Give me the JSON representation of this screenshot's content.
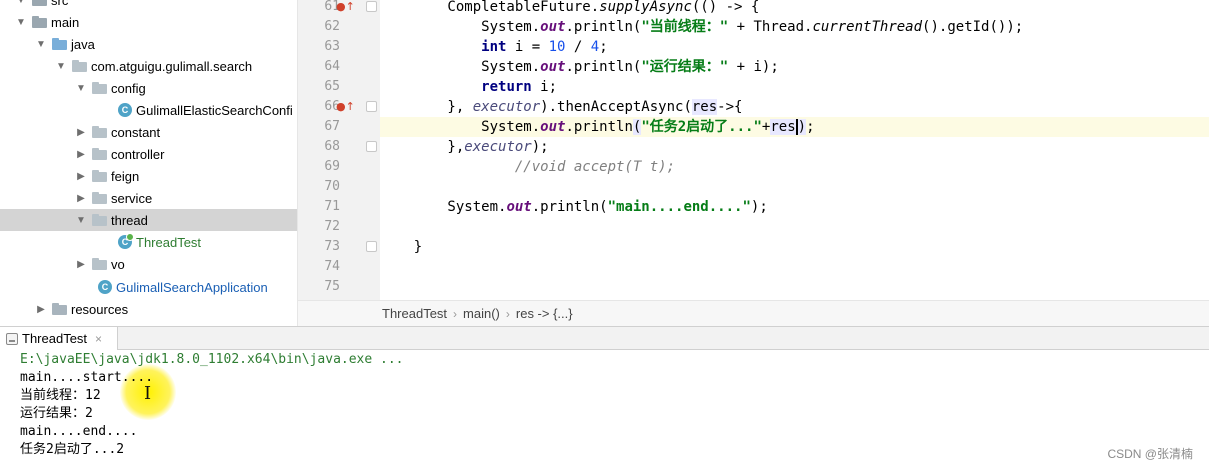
{
  "tree": {
    "items": [
      {
        "label": "src",
        "kind": "folder"
      },
      {
        "label": "main",
        "kind": "folder"
      },
      {
        "label": "java",
        "kind": "folder"
      },
      {
        "label": "com.atguigu.gulimall.search",
        "kind": "package"
      },
      {
        "label": "config",
        "kind": "package"
      },
      {
        "label": "GulimallElasticSearchConfi",
        "kind": "class"
      },
      {
        "label": "constant",
        "kind": "package"
      },
      {
        "label": "controller",
        "kind": "package"
      },
      {
        "label": "feign",
        "kind": "package"
      },
      {
        "label": "service",
        "kind": "package"
      },
      {
        "label": "thread",
        "kind": "package"
      },
      {
        "label": "ThreadTest",
        "kind": "class"
      },
      {
        "label": "vo",
        "kind": "package"
      },
      {
        "label": "GulimallSearchApplication",
        "kind": "class"
      },
      {
        "label": "resources",
        "kind": "folder"
      }
    ]
  },
  "editor": {
    "line_numbers": [
      "61",
      "62",
      "63",
      "64",
      "65",
      "66",
      "67",
      "68",
      "69",
      "70",
      "71",
      "72",
      "73",
      "74",
      "75"
    ],
    "lines": {
      "l61_a": "        CompletableFuture.",
      "l61_b": "supplyAsync",
      "l61_c": "(() -> {",
      "l62_a": "            System.",
      "l62_out": "out",
      "l62_b": ".println(",
      "l62_str": "\"当前线程：\"",
      "l62_c": " + Thread.",
      "l62_d": "currentThread",
      "l62_e": "().getId());",
      "l63_kw": "int",
      "l63_a": " i = ",
      "l63_n1": "10",
      "l63_b": " / ",
      "l63_n2": "4",
      "l63_c": ";",
      "l64_a": "            System.",
      "l64_out": "out",
      "l64_b": ".println(",
      "l64_str": "\"运行结果：\"",
      "l64_c": " + i);",
      "l65_kw": "return",
      "l65_a": " i;",
      "l66_a": "        }, ",
      "l66_exec": "executor",
      "l66_b": ").thenAcceptAsync(",
      "l66_res": "res",
      "l66_c": "->{",
      "l67_a": "            System.",
      "l67_out": "out",
      "l67_b": ".println",
      "l67_p1": "(",
      "l67_str": "\"任务2启动了...\"",
      "l67_c": "+",
      "l67_res": "res",
      "l67_p2": ")",
      "l67_d": ";",
      "l68_a": "        },",
      "l68_exec": "executor",
      "l68_b": ");",
      "l69_cm": "//void accept(T t);",
      "l71_a": "        System.",
      "l71_out": "out",
      "l71_b": ".println(",
      "l71_str": "\"main....end....\"",
      "l71_c": ");",
      "l73_a": "    }"
    }
  },
  "breadcrumb": [
    "ThreadTest",
    "main()",
    "res -> {...}"
  ],
  "run": {
    "tab_label": "ThreadTest",
    "close_glyph": "×"
  },
  "console": {
    "lines": [
      "E:\\javaEE\\java\\jdk1.8.0_1102.x64\\bin\\java.exe ...",
      "main....start....",
      "当前线程：12",
      "运行结果：2",
      "main....end....",
      "任务2启动了...2"
    ]
  },
  "watermark": "CSDN @张清楠",
  "icons": {
    "arrow_expanded": "chevron-down-icon",
    "arrow_collapsed": "chevron-right-icon",
    "folder": "folder-icon",
    "class": "java-class-icon",
    "override": "override-up-arrow-icon"
  },
  "colors": {
    "string": "#067d17",
    "keyword": "#000080",
    "field": "#660e7a",
    "comment": "#808080",
    "selected_row": "#d4d4d4",
    "current_line": "#fdfbe3"
  }
}
